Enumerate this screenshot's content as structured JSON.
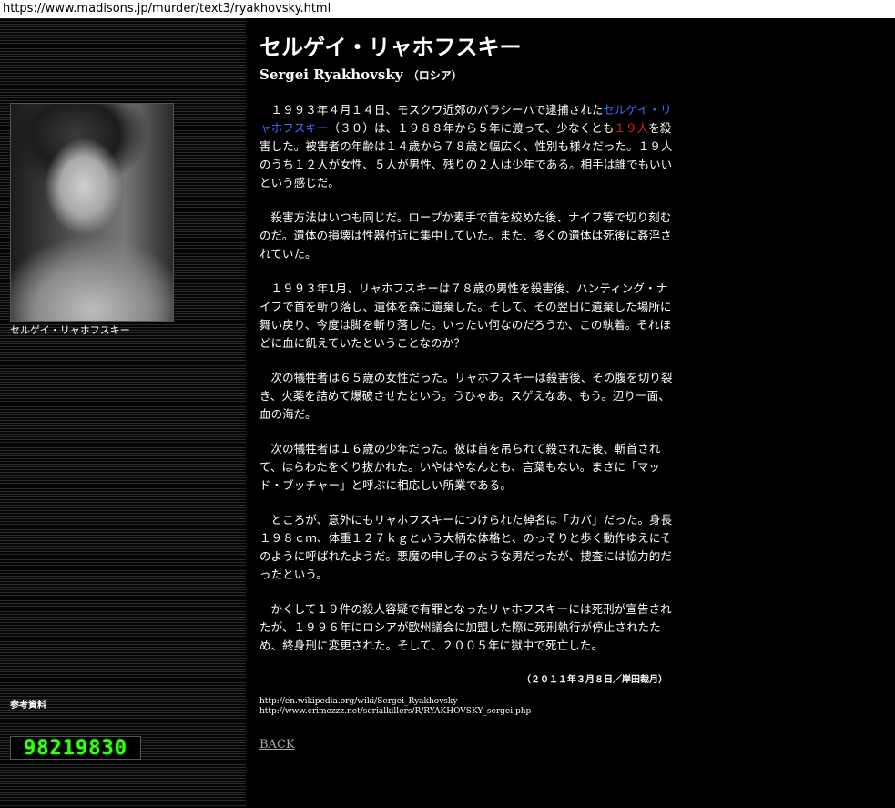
{
  "browser": {
    "url": "https://www.madisons.jp/murder/text3/ryakhovsky.html"
  },
  "sidebar": {
    "photo_caption": "セルゲイ・リャホフスキー",
    "ref_label": "参考資料",
    "counter": "98219830"
  },
  "header": {
    "title": "セルゲイ・リャホフスキー",
    "subtitle_name": "Sergei Ryakhovsky",
    "subtitle_country": "（ロシア）"
  },
  "article": {
    "p1_before": "１９９３年４月１４日、モスクワ近郊のバラシーハで逮捕された",
    "p1_name": "セルゲイ・リャホフスキー",
    "p1_mid": "（３０）は、１９８８年から５年に渡って、少なくとも",
    "p1_count": "１９人",
    "p1_after": "を殺害した。被害者の年齢は１４歳から７８歳と幅広く、性別も様々だった。１９人のうち１２人が女性、５人が男性、残りの２人は少年である。相手は誰でもいいという感じだ。",
    "p2": "殺害方法はいつも同じだ。ロープか素手で首を絞めた後、ナイフ等で切り刻むのだ。遺体の損壊は性器付近に集中していた。また、多くの遺体は死後に姦淫されていた。",
    "p3": "１９９３年1月、リャホフスキーは７８歳の男性を殺害後、ハンティング・ナイフで首を斬り落し、遺体を森に遺棄した。そして、その翌日に遺棄した場所に舞い戻り、今度は脚を斬り落した。いったい何なのだろうか、この執着。それほどに血に飢えていたということなのか？",
    "p4": "次の犠牲者は６５歳の女性だった。リャホフスキーは殺害後、その腹を切り裂き、火薬を詰めて爆破させたという。うひゃあ。スゲえなあ、もう。辺り一面、血の海だ。",
    "p5": "次の犠牲者は１６歳の少年だった。彼は首を吊られて殺された後、斬首されて、はらわたをくり抜かれた。いやはやなんとも、言葉もない。まさに「マッド・ブッチャー」と呼ぶに相応しい所業である。",
    "p6": "ところが、意外にもリャホフスキーにつけられた綽名は「カバ」だった。身長１９８ｃｍ、体重１２７ｋｇという大柄な体格と、のっそりと歩く動作ゆえにそのように呼ばれたようだ。悪魔の申し子のような男だったが、捜査には協力的だったという。",
    "p7": "かくして１９件の殺人容疑で有罪となったリャホフスキーには死刑が宣告されたが、１９９６年にロシアが欧州議会に加盟した際に死刑執行が停止されたため、終身刑に変更された。そして、２００５年に獄中で死亡した。",
    "date": "（２０１１年３月８日／岸田裁月）"
  },
  "references": {
    "links": [
      "http://en.wikipedia.org/wiki/Sergei_Ryakhovsky",
      "http://www.crimezzz.net/serialkillers/R/RYAKHOVSKY_sergei.php"
    ]
  },
  "nav": {
    "back_label": "BACK"
  },
  "colors": {
    "background": "#000000",
    "text": "#ffffff",
    "highlight_name": "#3b6dff",
    "highlight_count": "#e02020",
    "counter_digits": "#39ff14",
    "back_link": "#aaaaaa"
  }
}
